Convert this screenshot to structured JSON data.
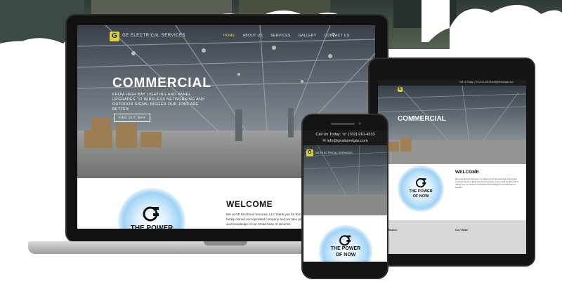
{
  "brand": {
    "logo_letter": "G",
    "name": "GE ELECTRICAL SERVICES"
  },
  "nav": {
    "items": [
      "HOME",
      "ABOUT US",
      "SERVICES",
      "GALLERY",
      "CONTACT US"
    ],
    "active_index": 0,
    "search_icon": "search-icon"
  },
  "hero": {
    "title": "COMMERCIAL",
    "subtitle": "FROM HIGH BAY LIGHTING AND PANEL UPGRADES TO WIRELESS NETWORKING AND OUTDOOR SIGNS, BIGGER OUR JOBS ARE BETTER",
    "button_label": "FIND OUT WHY"
  },
  "welcome": {
    "heading": "WELCOME",
    "paragraph": "We at GE Electrical Services, LLC thank you for this opportunity to introduce ourselves. We are a family owned and operated company and we take pride in making sure you receive the expertise and knowledge of our broad base of services."
  },
  "power_badge": {
    "line1": "THE POWER",
    "line2": "OF NOW",
    "icon": "plug-icon"
  },
  "tablet": {
    "topbar": "Call Us Today: (702) 910-4333   info@geelasvegas.com",
    "mission_heading": "Our Mission",
    "vision_heading": "Our Vision"
  },
  "phone": {
    "call_text": "Call Us Today: ☏ (702) 910-4333",
    "email_text": "✉ info@gealasvegas.com"
  },
  "colors": {
    "accent": "#e2d93d",
    "dark": "#111111",
    "sky_blue": "#9fd3f3"
  }
}
